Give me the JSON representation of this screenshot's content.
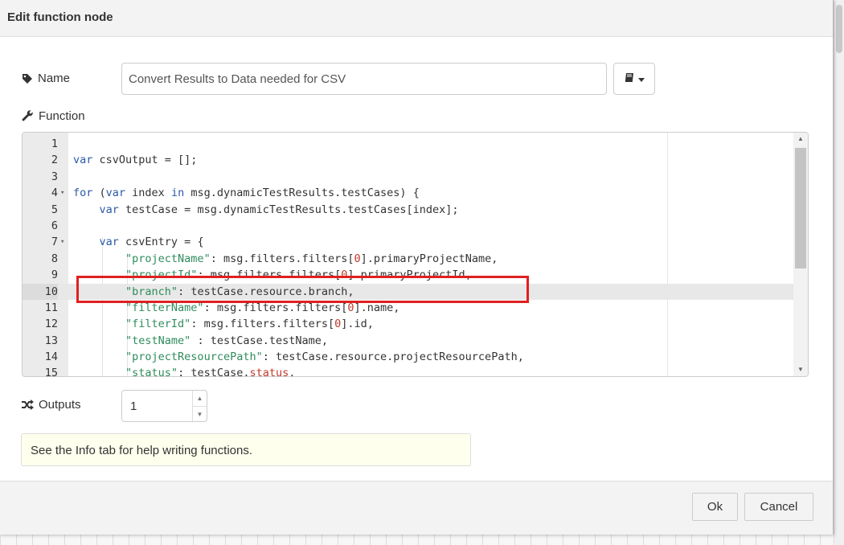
{
  "dialog": {
    "title": "Edit function node"
  },
  "name_field": {
    "label": "Name",
    "value": "Convert Results to Data needed for CSV"
  },
  "function_field": {
    "label": "Function"
  },
  "code_lines": [
    {
      "n": "1",
      "text": ""
    },
    {
      "n": "2",
      "text": "var csvOutput = [];"
    },
    {
      "n": "3",
      "text": ""
    },
    {
      "n": "4",
      "text": "for (var index in msg.dynamicTestResults.testCases) {"
    },
    {
      "n": "5",
      "text": "    var testCase = msg.dynamicTestResults.testCases[index];"
    },
    {
      "n": "6",
      "text": ""
    },
    {
      "n": "7",
      "text": "    var csvEntry = {"
    },
    {
      "n": "8",
      "text": "        \"projectName\": msg.filters.filters[0].primaryProjectName,"
    },
    {
      "n": "9",
      "text": "        \"projectId\": msg.filters.filters[0].primaryProjectId,"
    },
    {
      "n": "10",
      "text": "        \"branch\": testCase.resource.branch,"
    },
    {
      "n": "11",
      "text": "        \"filterName\": msg.filters.filters[0].name,"
    },
    {
      "n": "12",
      "text": "        \"filterId\": msg.filters.filters[0].id,"
    },
    {
      "n": "13",
      "text": "        \"testName\" : testCase.testName,"
    },
    {
      "n": "14",
      "text": "        \"projectResourcePath\": testCase.resource.projectResourcePath,"
    },
    {
      "n": "15",
      "text": "        \"status\": testCase.status,"
    }
  ],
  "active_line": "10",
  "outputs": {
    "label": "Outputs",
    "value": "1"
  },
  "tip": {
    "text": "See the Info tab for help writing functions."
  },
  "footer": {
    "ok_label": "Ok",
    "cancel_label": "Cancel"
  },
  "colors": {
    "keyword": "#2b5aa8",
    "string": "#2f8c5b",
    "number": "#c0392b",
    "highlight_box": "#e02020"
  }
}
